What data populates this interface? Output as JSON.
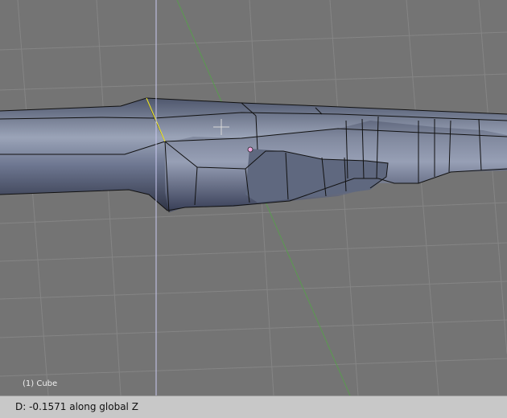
{
  "viewport": {
    "object_label": "(1) Cube",
    "colors": {
      "background": "#747474",
      "grid": "#858585",
      "y_axis": "#5a9a50",
      "transform_constraint_line": "#c8c8f0",
      "mesh_fill": "#7e879c",
      "mesh_wire": "#111111",
      "selected_edge": "#e8e030",
      "vertex_marker": "#f0a8e0"
    }
  },
  "status_bar": {
    "text": "D: -0.1571 along global Z"
  }
}
